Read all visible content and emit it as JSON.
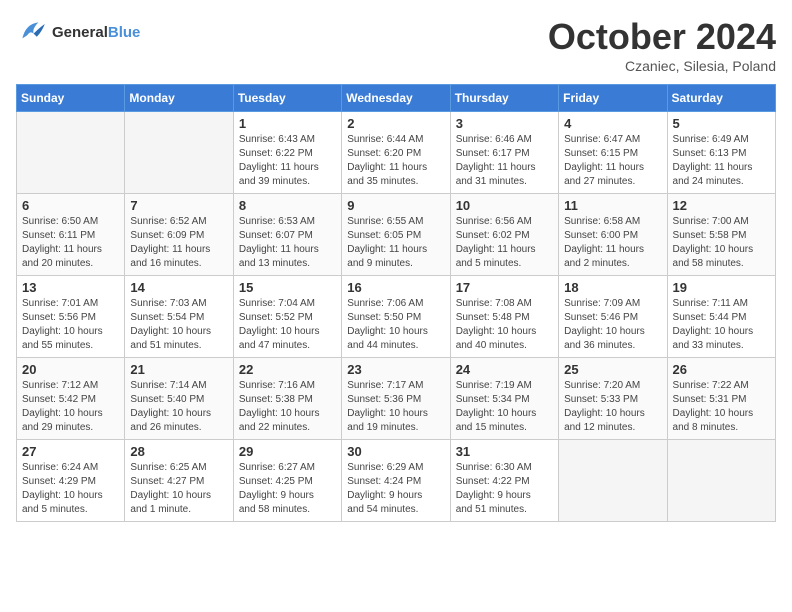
{
  "header": {
    "logo_line1": "General",
    "logo_line2": "Blue",
    "month": "October 2024",
    "location": "Czaniec, Silesia, Poland"
  },
  "weekdays": [
    "Sunday",
    "Monday",
    "Tuesday",
    "Wednesday",
    "Thursday",
    "Friday",
    "Saturday"
  ],
  "weeks": [
    [
      {
        "day": "",
        "info": ""
      },
      {
        "day": "",
        "info": ""
      },
      {
        "day": "1",
        "info": "Sunrise: 6:43 AM\nSunset: 6:22 PM\nDaylight: 11 hours\nand 39 minutes."
      },
      {
        "day": "2",
        "info": "Sunrise: 6:44 AM\nSunset: 6:20 PM\nDaylight: 11 hours\nand 35 minutes."
      },
      {
        "day": "3",
        "info": "Sunrise: 6:46 AM\nSunset: 6:17 PM\nDaylight: 11 hours\nand 31 minutes."
      },
      {
        "day": "4",
        "info": "Sunrise: 6:47 AM\nSunset: 6:15 PM\nDaylight: 11 hours\nand 27 minutes."
      },
      {
        "day": "5",
        "info": "Sunrise: 6:49 AM\nSunset: 6:13 PM\nDaylight: 11 hours\nand 24 minutes."
      }
    ],
    [
      {
        "day": "6",
        "info": "Sunrise: 6:50 AM\nSunset: 6:11 PM\nDaylight: 11 hours\nand 20 minutes."
      },
      {
        "day": "7",
        "info": "Sunrise: 6:52 AM\nSunset: 6:09 PM\nDaylight: 11 hours\nand 16 minutes."
      },
      {
        "day": "8",
        "info": "Sunrise: 6:53 AM\nSunset: 6:07 PM\nDaylight: 11 hours\nand 13 minutes."
      },
      {
        "day": "9",
        "info": "Sunrise: 6:55 AM\nSunset: 6:05 PM\nDaylight: 11 hours\nand 9 minutes."
      },
      {
        "day": "10",
        "info": "Sunrise: 6:56 AM\nSunset: 6:02 PM\nDaylight: 11 hours\nand 5 minutes."
      },
      {
        "day": "11",
        "info": "Sunrise: 6:58 AM\nSunset: 6:00 PM\nDaylight: 11 hours\nand 2 minutes."
      },
      {
        "day": "12",
        "info": "Sunrise: 7:00 AM\nSunset: 5:58 PM\nDaylight: 10 hours\nand 58 minutes."
      }
    ],
    [
      {
        "day": "13",
        "info": "Sunrise: 7:01 AM\nSunset: 5:56 PM\nDaylight: 10 hours\nand 55 minutes."
      },
      {
        "day": "14",
        "info": "Sunrise: 7:03 AM\nSunset: 5:54 PM\nDaylight: 10 hours\nand 51 minutes."
      },
      {
        "day": "15",
        "info": "Sunrise: 7:04 AM\nSunset: 5:52 PM\nDaylight: 10 hours\nand 47 minutes."
      },
      {
        "day": "16",
        "info": "Sunrise: 7:06 AM\nSunset: 5:50 PM\nDaylight: 10 hours\nand 44 minutes."
      },
      {
        "day": "17",
        "info": "Sunrise: 7:08 AM\nSunset: 5:48 PM\nDaylight: 10 hours\nand 40 minutes."
      },
      {
        "day": "18",
        "info": "Sunrise: 7:09 AM\nSunset: 5:46 PM\nDaylight: 10 hours\nand 36 minutes."
      },
      {
        "day": "19",
        "info": "Sunrise: 7:11 AM\nSunset: 5:44 PM\nDaylight: 10 hours\nand 33 minutes."
      }
    ],
    [
      {
        "day": "20",
        "info": "Sunrise: 7:12 AM\nSunset: 5:42 PM\nDaylight: 10 hours\nand 29 minutes."
      },
      {
        "day": "21",
        "info": "Sunrise: 7:14 AM\nSunset: 5:40 PM\nDaylight: 10 hours\nand 26 minutes."
      },
      {
        "day": "22",
        "info": "Sunrise: 7:16 AM\nSunset: 5:38 PM\nDaylight: 10 hours\nand 22 minutes."
      },
      {
        "day": "23",
        "info": "Sunrise: 7:17 AM\nSunset: 5:36 PM\nDaylight: 10 hours\nand 19 minutes."
      },
      {
        "day": "24",
        "info": "Sunrise: 7:19 AM\nSunset: 5:34 PM\nDaylight: 10 hours\nand 15 minutes."
      },
      {
        "day": "25",
        "info": "Sunrise: 7:20 AM\nSunset: 5:33 PM\nDaylight: 10 hours\nand 12 minutes."
      },
      {
        "day": "26",
        "info": "Sunrise: 7:22 AM\nSunset: 5:31 PM\nDaylight: 10 hours\nand 8 minutes."
      }
    ],
    [
      {
        "day": "27",
        "info": "Sunrise: 6:24 AM\nSunset: 4:29 PM\nDaylight: 10 hours\nand 5 minutes."
      },
      {
        "day": "28",
        "info": "Sunrise: 6:25 AM\nSunset: 4:27 PM\nDaylight: 10 hours\nand 1 minute."
      },
      {
        "day": "29",
        "info": "Sunrise: 6:27 AM\nSunset: 4:25 PM\nDaylight: 9 hours\nand 58 minutes."
      },
      {
        "day": "30",
        "info": "Sunrise: 6:29 AM\nSunset: 4:24 PM\nDaylight: 9 hours\nand 54 minutes."
      },
      {
        "day": "31",
        "info": "Sunrise: 6:30 AM\nSunset: 4:22 PM\nDaylight: 9 hours\nand 51 minutes."
      },
      {
        "day": "",
        "info": ""
      },
      {
        "day": "",
        "info": ""
      }
    ]
  ]
}
